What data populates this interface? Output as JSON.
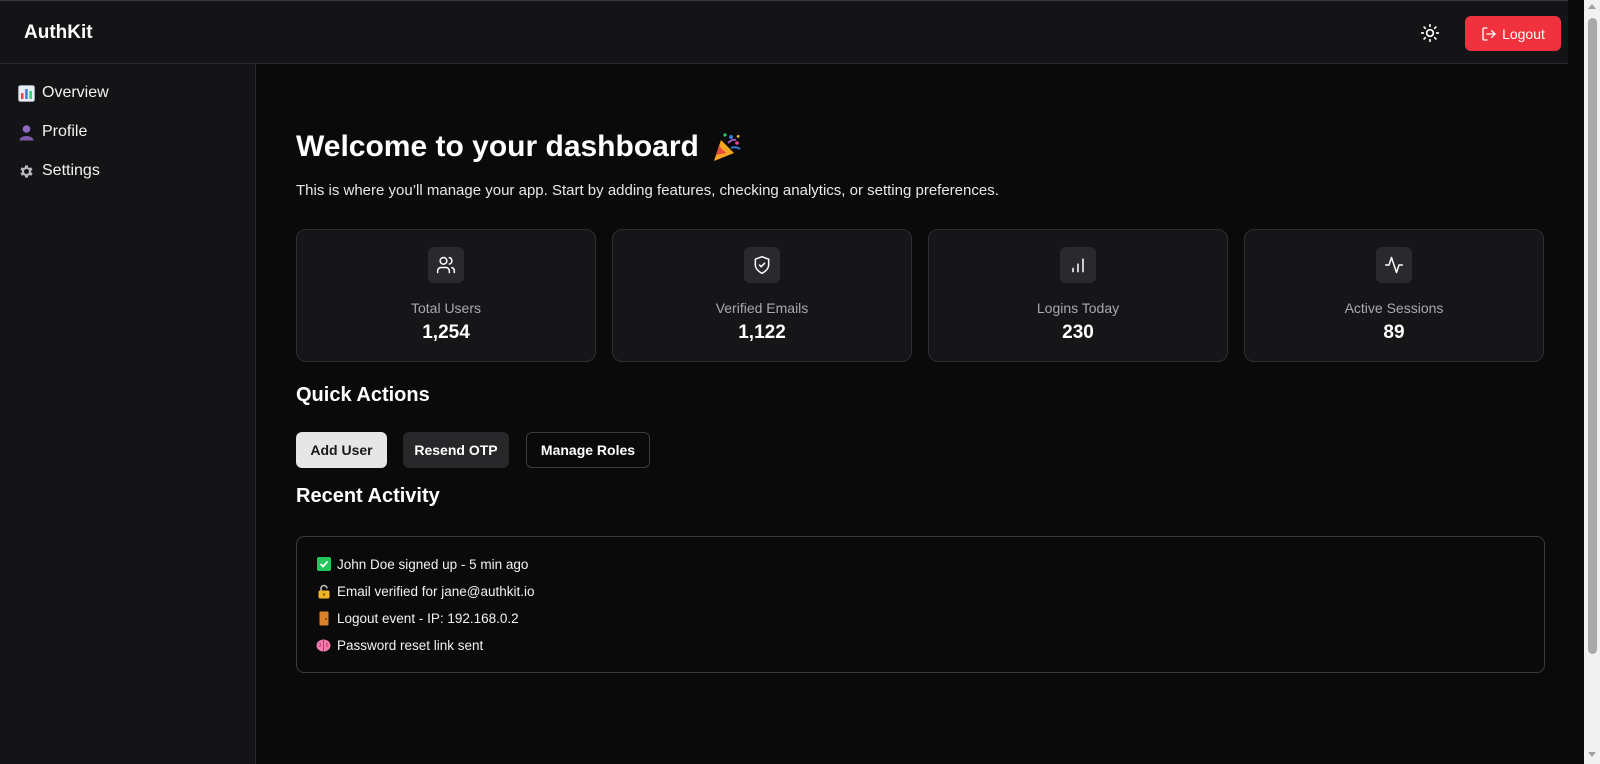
{
  "header": {
    "brand": "AuthKit",
    "logout_label": "Logout",
    "theme_icon": "sun-icon",
    "logout_color": "#f0313e"
  },
  "sidebar": {
    "items": [
      {
        "label": "Overview",
        "icon": "bar-chart-icon"
      },
      {
        "label": "Profile",
        "icon": "person-icon"
      },
      {
        "label": "Settings",
        "icon": "gear-icon"
      }
    ]
  },
  "main": {
    "title": "Welcome to your dashboard",
    "title_emoji": "party-popper-icon",
    "subtitle": "This is where you’ll manage your app. Start by adding features, checking analytics, or setting preferences.",
    "stats": [
      {
        "label": "Total Users",
        "value": "1,254",
        "icon": "users-icon"
      },
      {
        "label": "Verified Emails",
        "value": "1,122",
        "icon": "shield-check-icon"
      },
      {
        "label": "Logins Today",
        "value": "230",
        "icon": "bar-chart-icon"
      },
      {
        "label": "Active Sessions",
        "value": "89",
        "icon": "activity-icon"
      }
    ],
    "quick_actions_title": "Quick Actions",
    "quick_actions": [
      "Add User",
      "Resend OTP",
      "Manage Roles"
    ],
    "recent_activity_title": "Recent Activity",
    "activity": [
      {
        "text": "John Doe signed up - 5 min ago",
        "icon": "check-box-icon"
      },
      {
        "text": "Email verified for jane@authkit.io",
        "icon": "padlock-icon"
      },
      {
        "text": "Logout event - IP: 192.168.0.2",
        "icon": "door-icon"
      },
      {
        "text": "Password reset link sent",
        "icon": "brain-icon"
      }
    ]
  }
}
